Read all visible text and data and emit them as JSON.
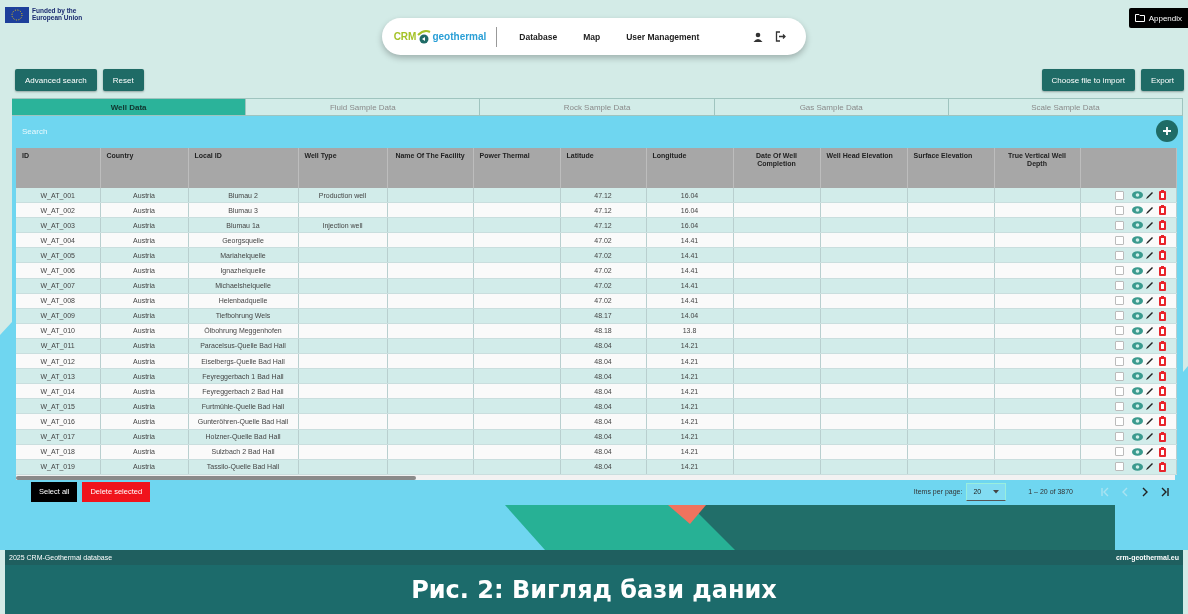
{
  "funding": {
    "text": "Funded by the European Union"
  },
  "nav": {
    "logo": [
      "CRM",
      "geothermal"
    ],
    "items": [
      {
        "label": "Database"
      },
      {
        "label": "Map"
      },
      {
        "label": "User Management"
      }
    ]
  },
  "appendix_button": {
    "label": "Appendix"
  },
  "toolbar": {
    "left": [
      "Advanced search",
      "Reset"
    ],
    "right": [
      "Choose file to import",
      "Export"
    ]
  },
  "tabs": [
    {
      "label": "Well Data",
      "selected": true
    },
    {
      "label": "Fluid Sample Data",
      "selected": false
    },
    {
      "label": "Rock Sample Data",
      "selected": false
    },
    {
      "label": "Gas Sample Data",
      "selected": false
    },
    {
      "label": "Scale Sample Data",
      "selected": false
    }
  ],
  "search": {
    "placeholder": "Search"
  },
  "table": {
    "columns": [
      "ID",
      "Country",
      "Local ID",
      "Well Type",
      "Name Of The Facility",
      "Power Thermal",
      "Latitude",
      "Longitude",
      "Date Of Well Completion",
      "Well Head Elevation",
      "Surface Elevation",
      "True Vertical Well Depth"
    ],
    "rows": [
      {
        "id": "W_AT_001",
        "country": "Austria",
        "local_id": "Blumau 2",
        "well_type": "Production well",
        "latitude": "47.12",
        "longitude": "16.04",
        "checked": false
      },
      {
        "id": "W_AT_002",
        "country": "Austria",
        "local_id": "Blumau 3",
        "latitude": "47.12",
        "longitude": "16.04",
        "checked": false
      },
      {
        "id": "W_AT_003",
        "country": "Austria",
        "local_id": "Blumau 1a",
        "well_type": "Injection well",
        "latitude": "47.12",
        "longitude": "16.04",
        "checked": false
      },
      {
        "id": "W_AT_004",
        "country": "Austria",
        "local_id": "Georgsquelle",
        "latitude": "47.02",
        "longitude": "14.41",
        "checked": false
      },
      {
        "id": "W_AT_005",
        "country": "Austria",
        "local_id": "Mariahelquelle",
        "latitude": "47.02",
        "longitude": "14.41",
        "checked": false
      },
      {
        "id": "W_AT_006",
        "country": "Austria",
        "local_id": "Ignazhelquelle",
        "latitude": "47.02",
        "longitude": "14.41",
        "checked": false
      },
      {
        "id": "W_AT_007",
        "country": "Austria",
        "local_id": "Michaelshelquelle",
        "latitude": "47.02",
        "longitude": "14.41",
        "checked": false
      },
      {
        "id": "W_AT_008",
        "country": "Austria",
        "local_id": "Helenbadquelle",
        "latitude": "47.02",
        "longitude": "14.41",
        "checked": false
      },
      {
        "id": "W_AT_009",
        "country": "Austria",
        "local_id": "Tiefbohrung Wels",
        "latitude": "48.17",
        "longitude": "14.04",
        "checked": false
      },
      {
        "id": "W_AT_010",
        "country": "Austria",
        "local_id": "Ölbohrung Meggenhofen",
        "latitude": "48.18",
        "longitude": "13.8",
        "checked": false
      },
      {
        "id": "W_AT_011",
        "country": "Austria",
        "local_id": "Paracelsus-Quelle Bad Hall",
        "latitude": "48.04",
        "longitude": "14.21",
        "checked": false
      },
      {
        "id": "W_AT_012",
        "country": "Austria",
        "local_id": "Eiselbergs-Quelle Bad Hall",
        "latitude": "48.04",
        "longitude": "14.21",
        "checked": false
      },
      {
        "id": "W_AT_013",
        "country": "Austria",
        "local_id": "Feyreggerbach 1 Bad Hall",
        "latitude": "48.04",
        "longitude": "14.21",
        "checked": false
      },
      {
        "id": "W_AT_014",
        "country": "Austria",
        "local_id": "Feyreggerbach 2 Bad Hall",
        "latitude": "48.04",
        "longitude": "14.21",
        "checked": false
      },
      {
        "id": "W_AT_015",
        "country": "Austria",
        "local_id": "Furtmühle-Quelle Bad Hall",
        "latitude": "48.04",
        "longitude": "14.21",
        "checked": false
      },
      {
        "id": "W_AT_016",
        "country": "Austria",
        "local_id": "Gunteröhren-Quelle Bad Hall",
        "latitude": "48.04",
        "longitude": "14.21",
        "checked": false
      },
      {
        "id": "W_AT_017",
        "country": "Austria",
        "local_id": "Holzner-Quelle Bad Hall",
        "latitude": "48.04",
        "longitude": "14.21",
        "checked": false
      },
      {
        "id": "W_AT_018",
        "country": "Austria",
        "local_id": "Sulzbach 2 Bad Hall",
        "latitude": "48.04",
        "longitude": "14.21",
        "checked": false
      },
      {
        "id": "W_AT_019",
        "country": "Austria",
        "local_id": "Tassilo-Quelle Bad Hall",
        "latitude": "48.04",
        "longitude": "14.21",
        "checked": false
      }
    ]
  },
  "table_actions": [
    {
      "label": "Select all",
      "kind": "primary"
    },
    {
      "label": "Delete selected",
      "kind": "danger"
    }
  ],
  "paginator": {
    "items_per_page_label": "Items per page:",
    "page_size": "20",
    "range": "1 – 20 of 3870",
    "buttons": [
      {
        "kind": "first",
        "disabled": true
      },
      {
        "kind": "previous",
        "disabled": true
      },
      {
        "kind": "next",
        "disabled": false
      },
      {
        "kind": "last",
        "disabled": false
      }
    ]
  },
  "footer": {
    "left": "2025 CRM-Geothermal database",
    "right": "crm-geothermal.eu"
  },
  "caption": "Рис. 2: Вигляд бази даних"
}
